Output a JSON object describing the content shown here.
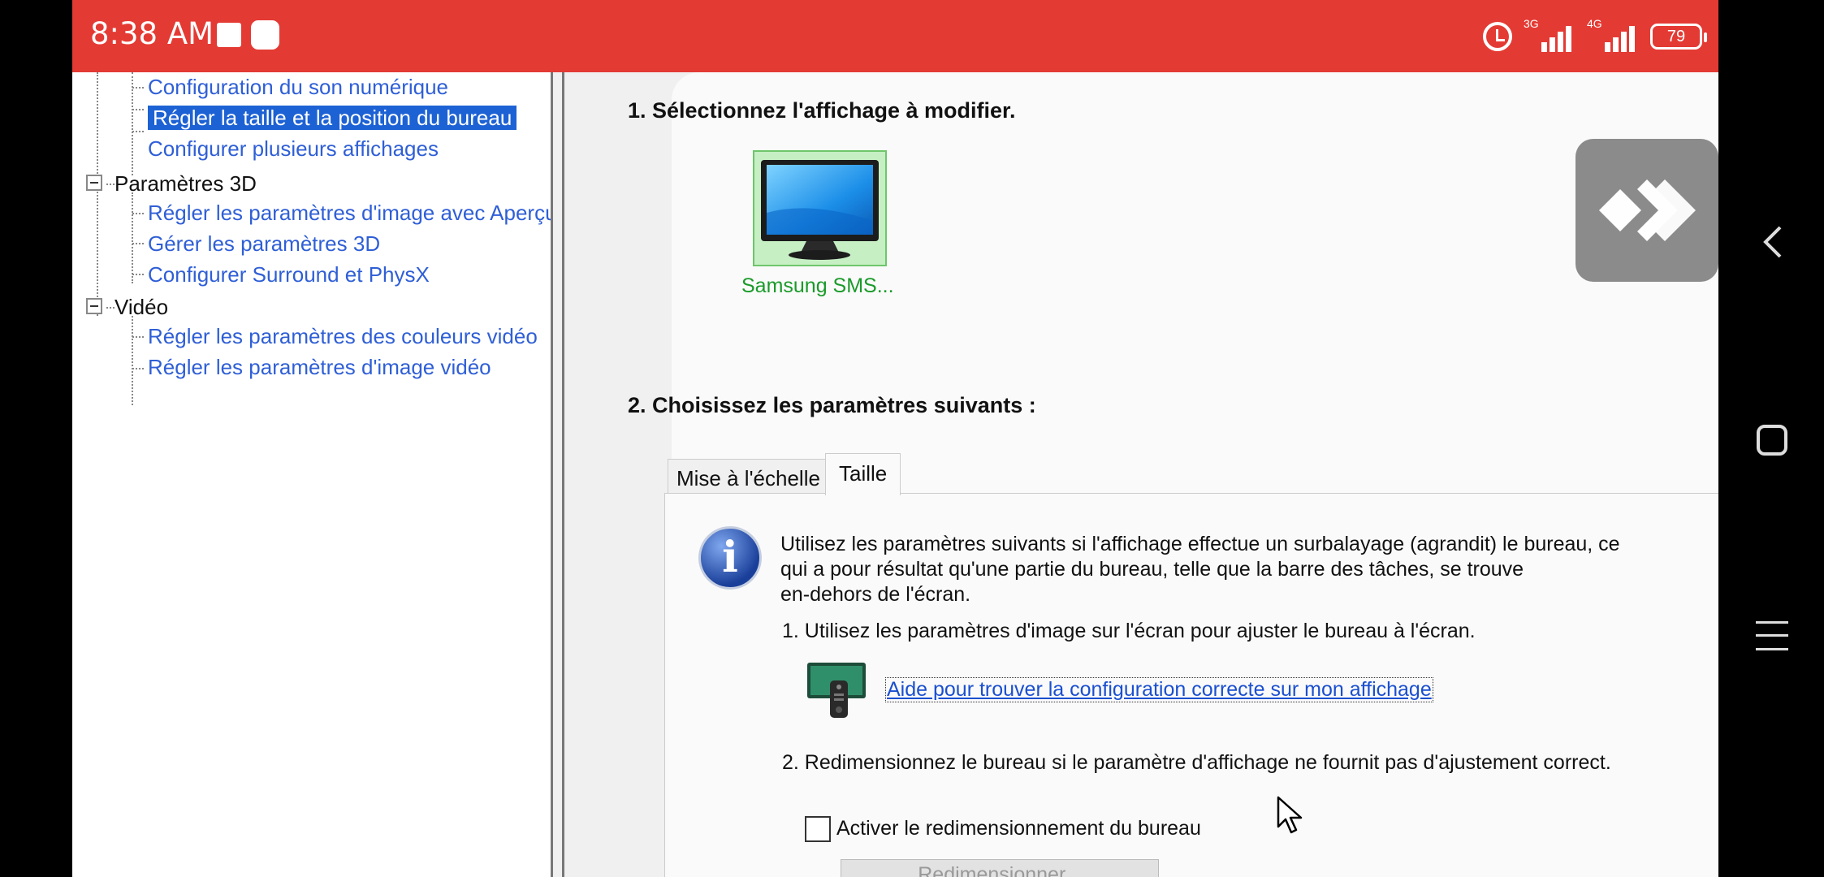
{
  "status_bar": {
    "time": "8:38 AM",
    "network1": "3G",
    "network2": "4G",
    "battery": "79"
  },
  "tree": {
    "items": [
      {
        "label": "Configuration du son numérique",
        "type": "child"
      },
      {
        "label": "Régler la taille et la position du bureau",
        "type": "child",
        "selected": true
      },
      {
        "label": "Configurer plusieurs affichages",
        "type": "child"
      },
      {
        "label": "Paramètres 3D",
        "type": "category"
      },
      {
        "label": "Régler les paramètres d'image avec Aperçu",
        "type": "child"
      },
      {
        "label": "Gérer les paramètres 3D",
        "type": "child"
      },
      {
        "label": "Configurer Surround et PhysX",
        "type": "child"
      },
      {
        "label": "Vidéo",
        "type": "category"
      },
      {
        "label": "Régler les paramètres des couleurs vidéo",
        "type": "child"
      },
      {
        "label": "Régler les paramètres d'image vidéo",
        "type": "child"
      }
    ]
  },
  "main": {
    "section1_title": "1. Sélectionnez l'affichage à modifier.",
    "display_label": "Samsung SMS...",
    "section2_title": "2. Choisissez les paramètres suivants :",
    "tabs": [
      {
        "label": "Mise à l'échelle",
        "active": false
      },
      {
        "label": "Taille",
        "active": true
      }
    ],
    "info_line1": "Utilisez les paramètres suivants si l'affichage effectue un surbalayage (agrandit) le bureau, ce",
    "info_line2": "qui a pour résultat qu'une partie du bureau, telle que la barre des tâches, se trouve",
    "info_line3": "en-dehors de l'écran.",
    "step1": "1. Utilisez les paramètres d'image sur l'écran pour ajuster le bureau à l'écran.",
    "help_link": "Aide pour trouver la configuration correcte sur mon affichage",
    "step2": "2. Redimensionnez le bureau si le paramètre d'affichage ne fournit pas d'ajustement correct.",
    "checkbox_label": "Activer le redimensionnement du bureau",
    "checkbox_checked": false,
    "resize_button": "Redimensionner..."
  },
  "colors": {
    "status_bar": "#e43a34",
    "selection": "#1d62d4",
    "link": "#2f5fd6",
    "display_label": "#1a9a2a"
  }
}
